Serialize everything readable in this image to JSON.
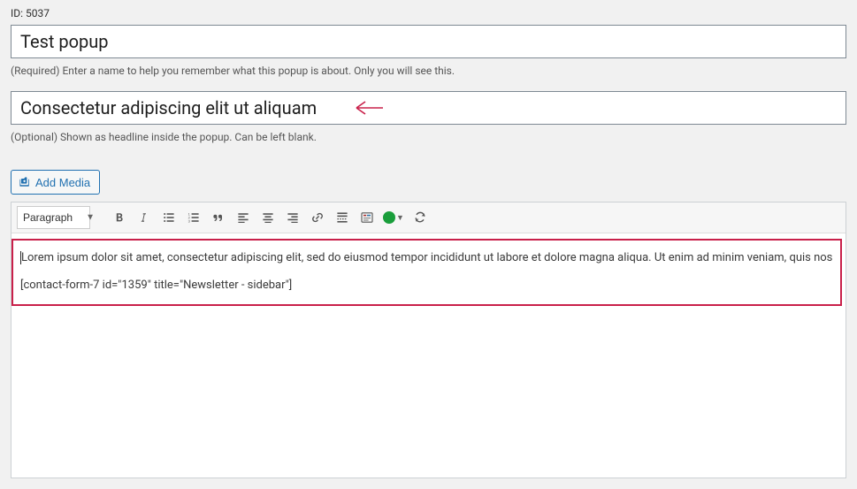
{
  "id_label": "ID: 5037",
  "name_input": {
    "value": "Test popup",
    "helper": "(Required) Enter a name to help you remember what this popup is about. Only you will see this."
  },
  "headline_input": {
    "value": "Consectetur adipiscing elit ut aliquam",
    "helper": "(Optional) Shown as headline inside the popup. Can be left blank."
  },
  "add_media_label": "Add Media",
  "toolbar": {
    "format_option": "Paragraph"
  },
  "editor": {
    "paragraph": "Lorem ipsum dolor sit amet, consectetur adipiscing elit, sed do eiusmod tempor incididunt ut labore et dolore magna aliqua. Ut enim ad minim veniam, quis nos",
    "shortcode": "[contact-form-7 id=\"1359\" title=\"Newsletter - sidebar\"]"
  }
}
